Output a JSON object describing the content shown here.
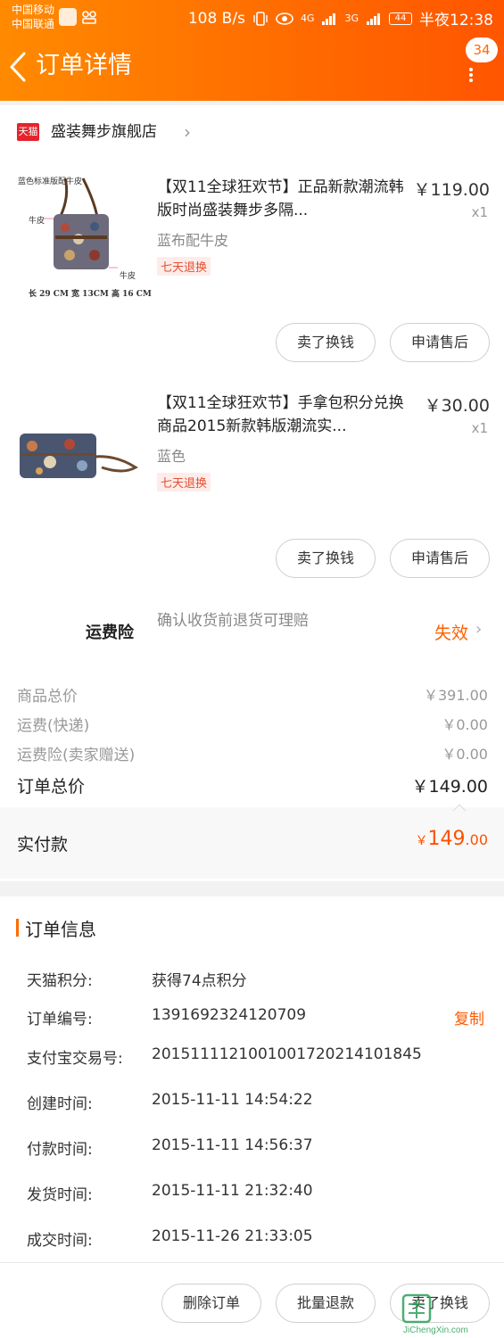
{
  "status_bar": {
    "carrier1": "中国移动",
    "carrier2": "中国联通",
    "speed": "108 B/s",
    "net1": "4G",
    "net2": "3G",
    "battery": "44",
    "time": "半夜12:38"
  },
  "header": {
    "title": "订单详情",
    "message_count": "34"
  },
  "store": {
    "badge": "天猫",
    "name": "盛装舞步旗舰店"
  },
  "items": [
    {
      "thumb_caption_top": "蓝色标准版配牛皮",
      "thumb_caption_left": "牛皮",
      "thumb_caption_right": "牛皮",
      "thumb_caption_bottom": "长 29 CM 宽 13CM 高 16 CM",
      "title": "【双11全球狂欢节】正品新款潮流韩版时尚盛装舞步多隔...",
      "price": "￥119.00",
      "qty": "x1",
      "sku": "蓝布配牛皮",
      "tag": "七天退换",
      "btn_sell": "卖了换钱",
      "btn_service": "申请售后"
    },
    {
      "title": "【双11全球狂欢节】手拿包积分兑换商品2015新款韩版潮流实...",
      "price": "￥30.00",
      "qty": "x1",
      "sku": "蓝色",
      "tag": "七天退换",
      "btn_sell": "卖了换钱",
      "btn_service": "申请售后"
    }
  ],
  "insurance": {
    "label": "运费险",
    "desc": "确认收货前退货可理赔",
    "status": "失效"
  },
  "summary": {
    "goods_label": "商品总价",
    "goods_value": "￥391.00",
    "shipping_label": "运费(快递)",
    "shipping_value": "￥0.00",
    "ins_label": "运费险(卖家赠送)",
    "ins_value": "￥0.00",
    "total_label": "订单总价",
    "total_value": "￥149.00",
    "paid_label": "实付款",
    "paid_currency": "￥",
    "paid_int": "149",
    "paid_dec": ".00"
  },
  "order_info": {
    "title": "订单信息",
    "rows": [
      {
        "label": "天猫积分:",
        "value": "获得74点积分"
      },
      {
        "label": "订单编号:",
        "value": "1391692324120709"
      },
      {
        "label": "支付宝交易号:",
        "value": "2015111121001001720214101845"
      },
      {
        "label": "创建时间:",
        "value": "2015-11-11 14:54:22"
      },
      {
        "label": "付款时间:",
        "value": "2015-11-11 14:56:37"
      },
      {
        "label": "发货时间:",
        "value": "2015-11-11 21:32:40"
      },
      {
        "label": "成交时间:",
        "value": "2015-11-26 21:33:05"
      }
    ],
    "copy": "复制"
  },
  "bottom": {
    "delete": "删除订单",
    "batch_refund": "批量退款",
    "sell": "卖了换钱"
  },
  "watermark": {
    "text": "JiChengXin.com"
  },
  "colors": {
    "accent": "#ff6a00",
    "price_red": "#ff5000",
    "tmall_red": "#e4232b"
  }
}
